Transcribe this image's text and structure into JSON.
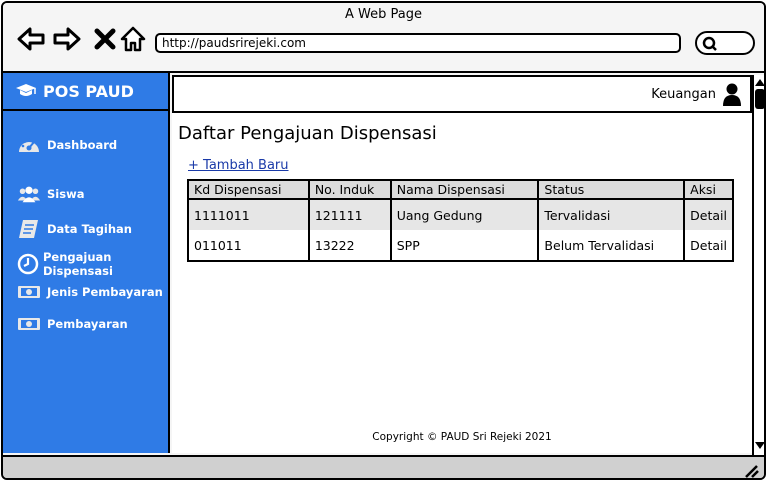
{
  "window": {
    "title": "A Web Page"
  },
  "browser": {
    "url": "http://paudsrirejeki.com"
  },
  "sidebar": {
    "brand": "POS PAUD",
    "items": [
      {
        "label": "Dashboard",
        "icon": "dashboard-icon"
      },
      {
        "label": "Siswa",
        "icon": "users-icon"
      },
      {
        "label": "Data Tagihan",
        "icon": "document-icon"
      },
      {
        "label": "Pengajuan Dispensasi",
        "icon": "clock-icon",
        "active": true
      },
      {
        "label": "Jenis Pembayaran",
        "icon": "money-icon"
      },
      {
        "label": "Pembayaran",
        "icon": "money-icon"
      }
    ]
  },
  "header": {
    "user_label": "Keuangan"
  },
  "main": {
    "title": "Daftar Pengajuan Dispensasi",
    "add_link": "+ Tambah Baru",
    "table": {
      "columns": [
        "Kd Dispensasi",
        "No. Induk",
        "Nama Dispensasi",
        "Status",
        "Aksi"
      ],
      "rows": [
        [
          "1111011",
          "121111",
          "Uang Gedung",
          "Tervalidasi",
          "Detail"
        ],
        [
          "011011",
          "13222",
          "SPP",
          "Belum Tervalidasi",
          "Detail"
        ]
      ]
    }
  },
  "footer": {
    "text": "Copyright © PAUD Sri Rejeki 2021"
  },
  "colors": {
    "sidebar": "#2f7be6",
    "link": "#1a3aa8"
  }
}
